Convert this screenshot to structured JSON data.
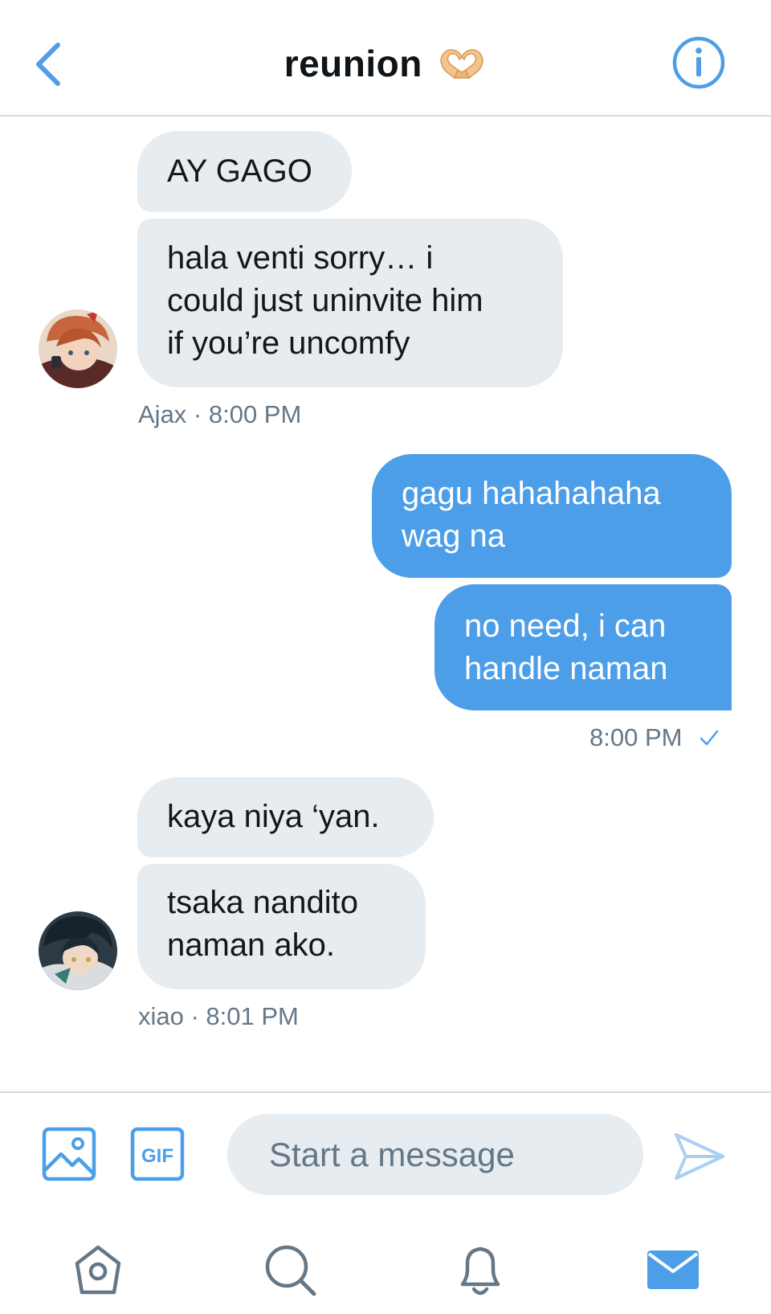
{
  "header": {
    "title": "reunion",
    "title_emoji": "heart-hands-emoji",
    "back_icon": "chevron-left-icon",
    "info_icon": "info-icon"
  },
  "messages": [
    {
      "sender": "Ajax",
      "direction": "incoming",
      "text_lines": [
        "AY GAGO"
      ]
    },
    {
      "sender": "Ajax",
      "direction": "incoming",
      "text_lines": [
        "hala venti sorry… i",
        "could just uninvite him",
        "if you’re uncomfy"
      ]
    },
    {
      "meta": "Ajax · 8:00 PM"
    },
    {
      "direction": "outgoing",
      "text_lines": [
        "gagu hahahahaha",
        "wag na"
      ]
    },
    {
      "direction": "outgoing",
      "text_lines": [
        "no need, i can",
        "handle naman"
      ]
    },
    {
      "meta": "8:00 PM",
      "status_icon": "checkmark-icon"
    },
    {
      "sender": "xiao",
      "direction": "incoming",
      "text_lines": [
        "kaya niya ‘yan."
      ]
    },
    {
      "sender": "xiao",
      "direction": "incoming",
      "text_lines": [
        "tsaka nandito",
        "naman ako."
      ]
    },
    {
      "meta": "xiao · 8:01 PM"
    }
  ],
  "composer": {
    "placeholder": "Start a message",
    "gif_label": "GIF",
    "image_icon": "image-icon",
    "send_icon": "send-icon"
  },
  "tabbar": {
    "items": [
      "home-icon",
      "search-icon",
      "notifications-icon",
      "messages-icon"
    ],
    "active": "messages-icon"
  },
  "colors": {
    "accent": "#4d9ee8",
    "incoming_bubble": "#e6ecf0",
    "meta_text": "#657786",
    "divider": "#d6dbe0"
  }
}
